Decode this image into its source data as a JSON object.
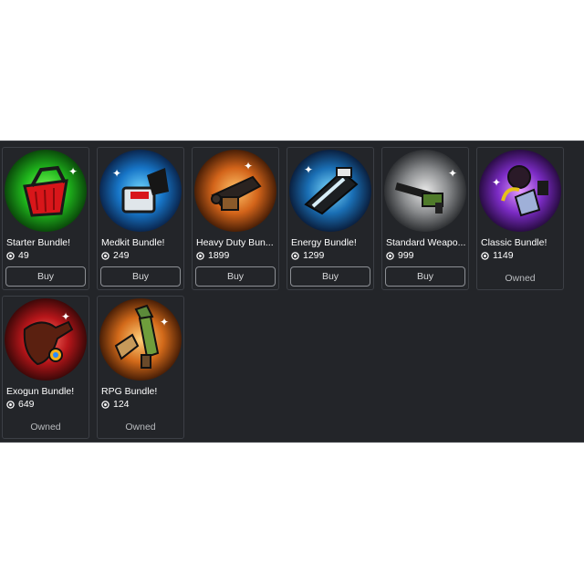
{
  "colors": {
    "panel_bg": "#232529",
    "card_border": "#3c3f45",
    "text": "#ffffff",
    "muted": "#b9bbbe"
  },
  "currency_icon": "robux-icon",
  "bundles": [
    {
      "name": "Starter Bundle!",
      "price": "49",
      "status": "Buy",
      "icon": "red-basket-icon",
      "glow": "green"
    },
    {
      "name": "Medkit Bundle!",
      "price": "249",
      "status": "Buy",
      "icon": "medkit-icon",
      "glow": "blue"
    },
    {
      "name": "Heavy Duty Bun...",
      "price": "1899",
      "status": "Buy",
      "icon": "heavy-gun-icon",
      "glow": "orange"
    },
    {
      "name": "Energy Bundle!",
      "price": "1299",
      "status": "Buy",
      "icon": "energy-gun-icon",
      "glow": "blue"
    },
    {
      "name": "Standard Weapo...",
      "price": "999",
      "status": "Buy",
      "icon": "rifle-icon",
      "glow": "gray"
    },
    {
      "name": "Classic Bundle!",
      "price": "1149",
      "status": "Owned",
      "icon": "classic-gear-icon",
      "glow": "purple"
    },
    {
      "name": "Exogun Bundle!",
      "price": "649",
      "status": "Owned",
      "icon": "exogun-icon",
      "glow": "red"
    },
    {
      "name": "RPG Bundle!",
      "price": "124",
      "status": "Owned",
      "icon": "rpg-launcher-icon",
      "glow": "orange"
    }
  ]
}
